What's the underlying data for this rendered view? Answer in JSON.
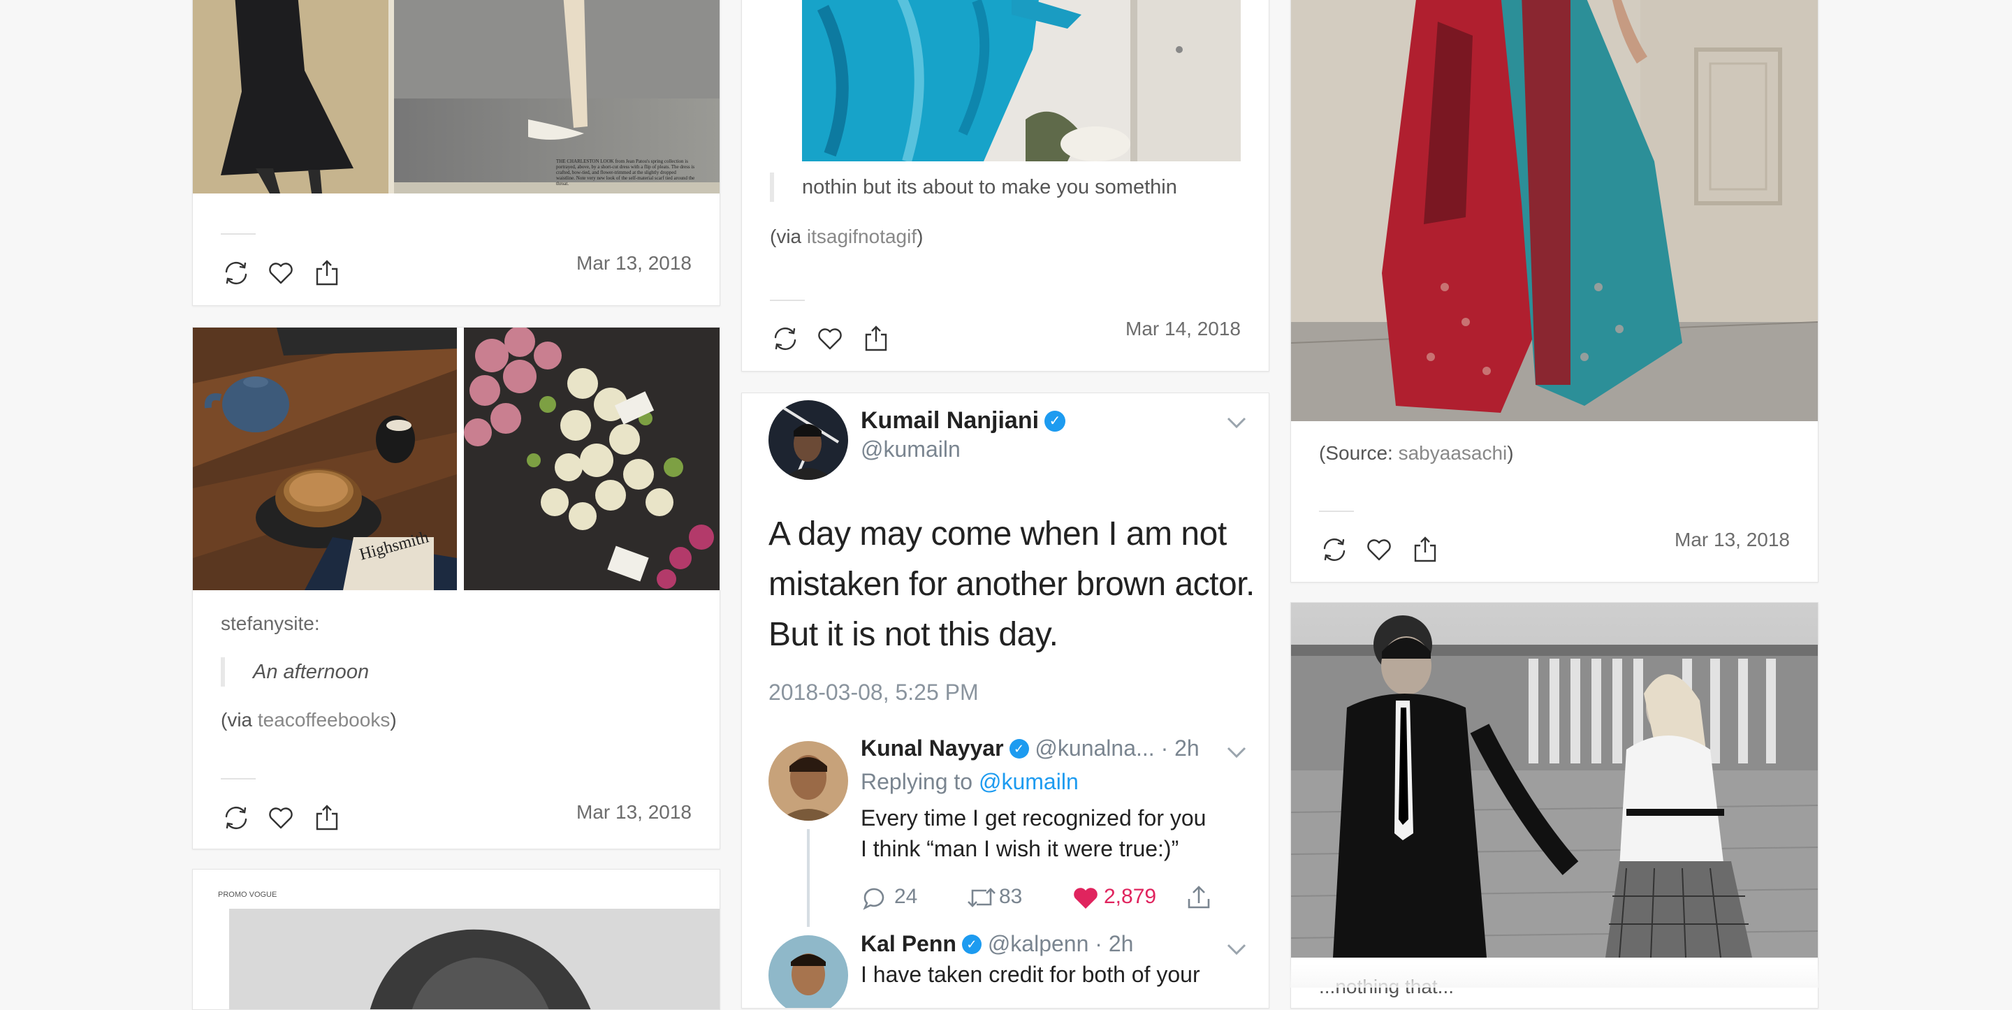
{
  "colors": {
    "page_bg": "#f7f7f7",
    "card_bg": "#ffffff",
    "link": "#888888",
    "verified": "#1d9bf0",
    "like_red": "#e0245e"
  },
  "posts": {
    "vintage_dress": {
      "date": "Mar 13, 2018",
      "img_text_title": "THE CHARLESTON LOOK",
      "img_text": "THE CHARLESTON LOOK from Jean Patou's spring collection is portrayed, above, by a short-cut dress with a flip of pleats. The dress is crafted, bow-tied, and flower-trimmed at the slightly dropped waistline. Note very new look of the self-material scarf tied around the throat."
    },
    "afternoon": {
      "author": "stefanysite:",
      "quote": "An afternoon",
      "via_prefix": "(via ",
      "via_link": "teacoffeebooks",
      "via_suffix": ")",
      "date": "Mar 13, 2018",
      "book_text": "Patricia Highsmith"
    },
    "gif_post": {
      "quote": "nothin but its about to make you somethin",
      "via_prefix": "(via ",
      "via_link": "itsagifnotagif",
      "via_suffix": ")",
      "date": "Mar 14, 2018"
    },
    "tweet": {
      "author_name": "Kumail Nanjiani",
      "author_handle": "@kumailn",
      "body": [
        "A day may come when I am not",
        "mistaken for another brown actor.",
        "But it is not this day."
      ],
      "timestamp": "2018-03-08, 5:25 PM",
      "reply1": {
        "name": "Kunal Nayyar",
        "handle": "@kunalna...",
        "time": "· 2h",
        "replying_prefix": "Replying to ",
        "replying_handle": "@kumailn",
        "text": [
          "Every time I get recognized for you",
          "I think “man I wish it were true:)”"
        ],
        "replies": "24",
        "retweets": "83",
        "likes": "2,879"
      },
      "reply2": {
        "name": "Kal Penn",
        "handle": "@kalpenn",
        "time": "· 2h",
        "text": "I have taken credit for both of your"
      }
    },
    "sari": {
      "source_prefix": "(Source: ",
      "source_link": "sabyaasachi",
      "source_suffix": ")",
      "date": "Mar 13, 2018"
    },
    "couple": {
      "caption_partial": "...nothing that..."
    },
    "vogue": {
      "label": "PROMO VOGUE"
    }
  }
}
